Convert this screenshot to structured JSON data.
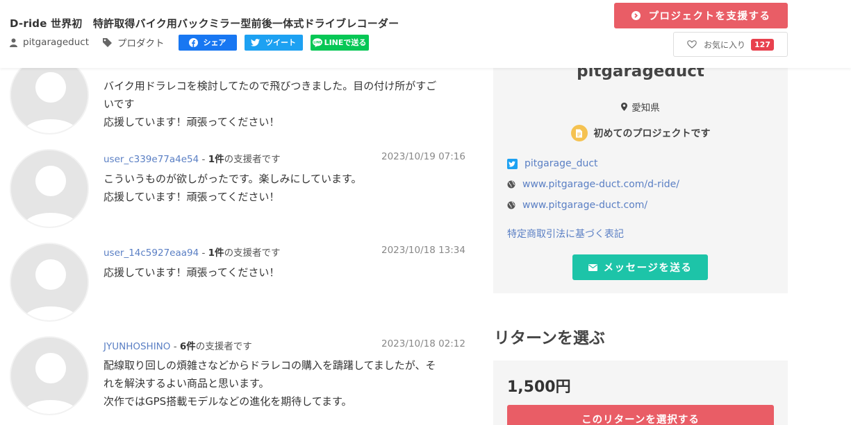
{
  "header": {
    "title": "D-ride 世界初　特許取得バイク用バックミラー型前後一体式ドライブレコーダー",
    "owner": "pitgarageduct",
    "category": "プロダクト",
    "share_facebook": "シェア",
    "share_twitter": "ツイート",
    "share_line": "LINEで送る",
    "support_button": "プロジェクトを支援する",
    "favorite_label": "お気に入り",
    "favorite_count": "127"
  },
  "comments": [
    {
      "user": "",
      "count": "",
      "suffix": "",
      "date": "",
      "lines": [
        "バイク用ドラレコを検討してたので飛びつきました。目の付け所がすご",
        "いです",
        "応援しています！頑張ってください！"
      ]
    },
    {
      "user": "user_c339e77a4e54",
      "count": "1件",
      "suffix": "の支援者です",
      "date": "2023/10/19 07:16",
      "lines": [
        "こういうものが欲しがったです。楽しみにしています。",
        "応援しています！頑張ってください！"
      ]
    },
    {
      "user": "user_14c5927eaa94",
      "count": "1件",
      "suffix": "の支援者です",
      "date": "2023/10/18 13:34",
      "lines": [
        "応援しています！頑張ってください！"
      ]
    },
    {
      "user": "JYUNHOSHINO",
      "count": "6件",
      "suffix": "の支援者です",
      "date": "2023/10/18 02:12",
      "lines": [
        "配線取り回しの煩雑さなどからドラレコの購入を躊躇してましたが、そ",
        "れを解決するよい商品と思います。",
        "次作ではGPS搭載モデルなどの進化を期待してます。"
      ]
    }
  ],
  "sidebar": {
    "owner_name": "pitgarageduct",
    "location": "愛知県",
    "first_project": "初めてのプロジェクトです",
    "twitter": "pitgarage_duct",
    "website_1": "www.pitgarage-duct.com/d-ride/",
    "website_2": "www.pitgarage-duct.com/",
    "law_link": "特定商取引法に基づく表記",
    "message_button": "メッセージを送る"
  },
  "returns": {
    "title": "リターンを選ぶ",
    "price": "1,500円",
    "select_button": "このリターンを選択する"
  },
  "colors": {
    "accent_red": "#e95d66",
    "teal": "#1dc4a8",
    "link_blue": "#5a7fc4",
    "facebook": "#1877f2",
    "twitter": "#1da1f2",
    "line": "#06c755"
  }
}
